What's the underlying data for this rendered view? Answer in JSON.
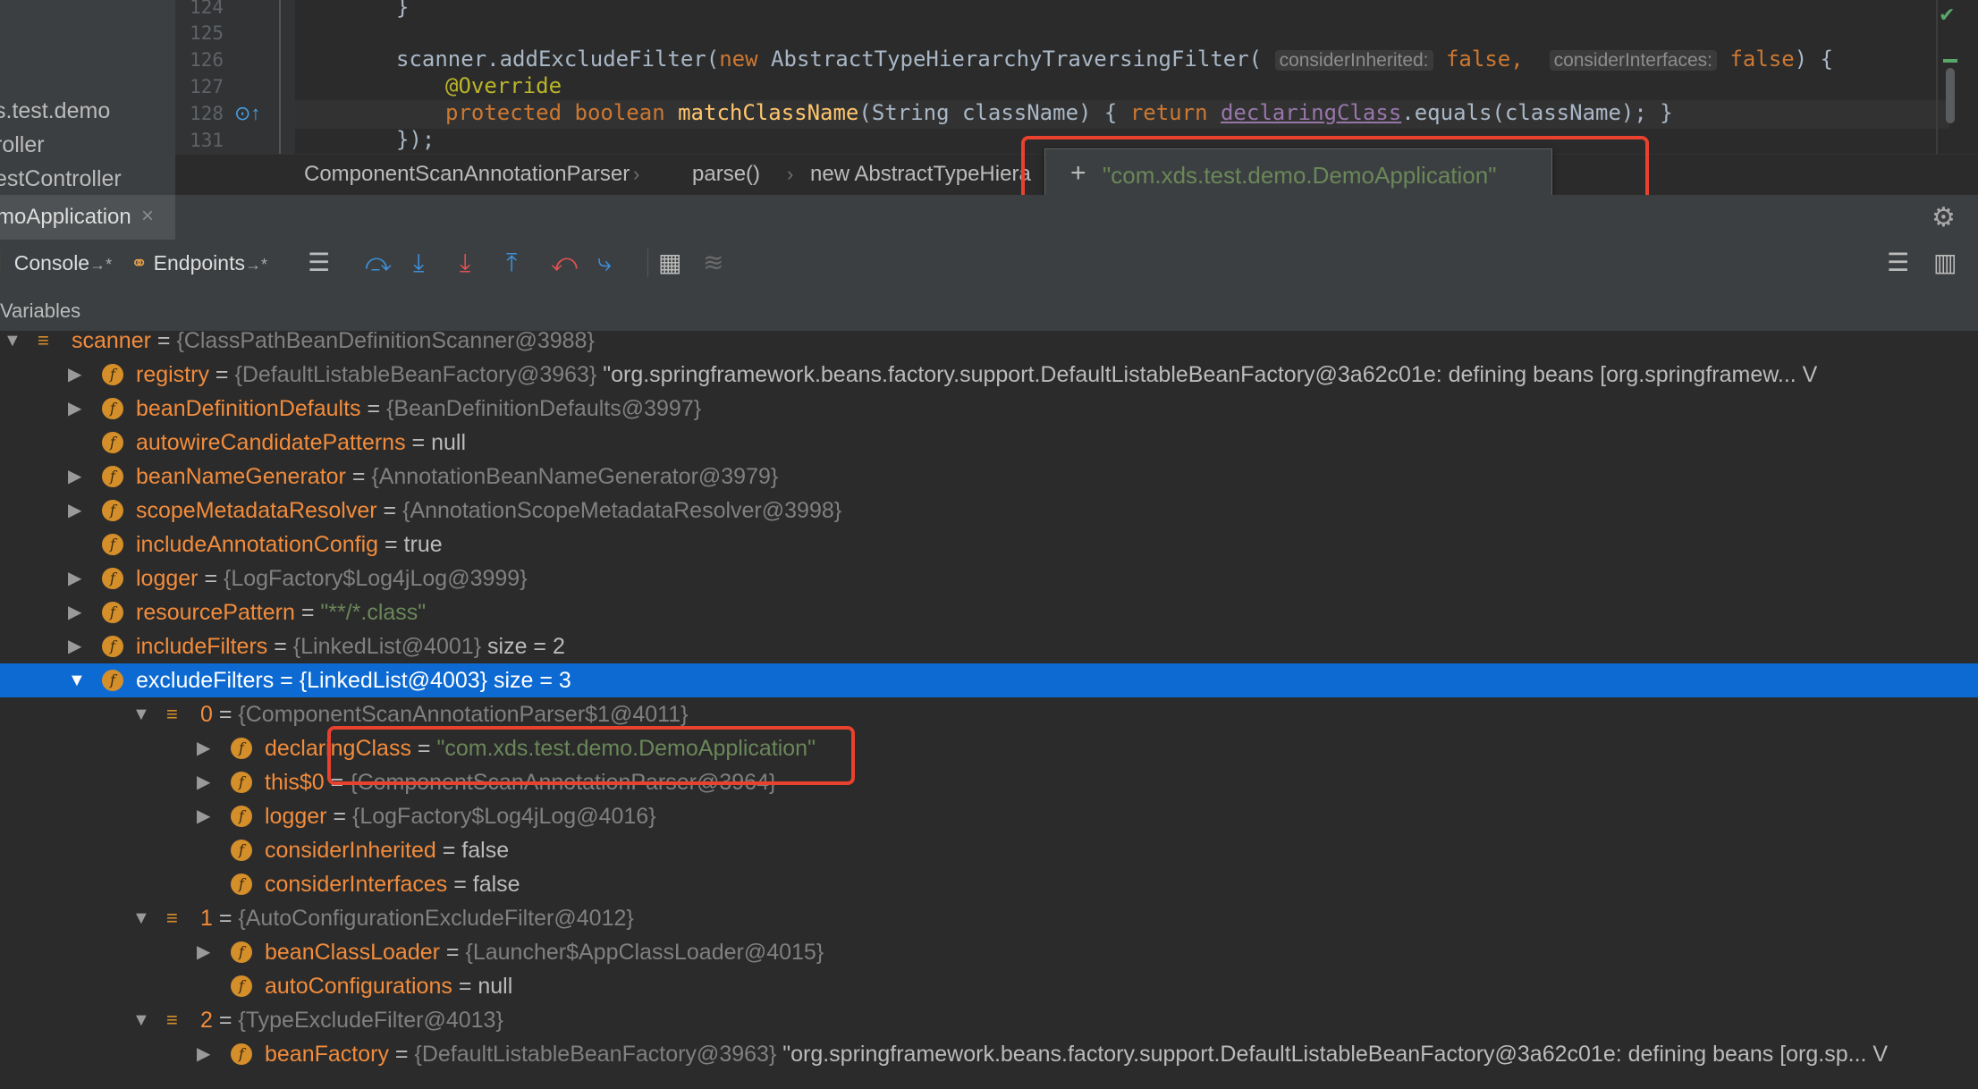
{
  "project": {
    "items": [
      "s.test.demo",
      "roller",
      "estController"
    ]
  },
  "editor": {
    "line_numbers": [
      "124",
      "125",
      "126",
      "127",
      "128",
      "131"
    ],
    "line_124": "}",
    "line_126_call": "scanner.addExcludeFilter(",
    "line_126_new": "new",
    "line_126_class": " AbstractTypeHierarchyTraversingFilter(",
    "hint_inherited": "considerInherited:",
    "hint_interfaces": "considerInterfaces:",
    "false_kw": "false",
    "line_126_close": ") {",
    "line_127": "@Override",
    "line_128_mods": "protected boolean ",
    "line_128_method": "matchClassName",
    "line_128_params": "(String className) { ",
    "line_128_return": "return ",
    "line_128_field": "declaringClass",
    "line_128_rest": ".equals(className); }",
    "line_131": "});"
  },
  "breadcrumbs": [
    "ComponentScanAnnotationParser",
    "parse()",
    "new AbstractTypeHiera"
  ],
  "tooltip": {
    "plus": "+",
    "value": "\"com.xds.test.demo.DemoApplication\""
  },
  "run_tab": {
    "label": "moApplication",
    "close": "×"
  },
  "toolbar": {
    "console": "Console",
    "endpoints": "Endpoints",
    "pin": "→*"
  },
  "variables_header": "Variables",
  "tree": [
    {
      "indent": 0,
      "expand": "down",
      "icon": "list",
      "name": "scanner",
      "eq": " = ",
      "type": "{ClassPathBeanDefinitionScanner@3988}",
      "value": "",
      "vclass": ""
    },
    {
      "indent": 1,
      "expand": "right",
      "icon": "field",
      "name": "registry",
      "eq": " = ",
      "type": "{DefaultListableBeanFactory@3963}",
      "value": " \"org.springframework.beans.factory.support.DefaultListableBeanFactory@3a62c01e: defining beans [org.springframew... V",
      "vclass": "plain"
    },
    {
      "indent": 1,
      "expand": "right",
      "icon": "field",
      "name": "beanDefinitionDefaults",
      "eq": " = ",
      "type": "{BeanDefinitionDefaults@3997}",
      "value": "",
      "vclass": ""
    },
    {
      "indent": 1,
      "expand": "none",
      "icon": "field",
      "name": "autowireCandidatePatterns",
      "eq": " = ",
      "type": "",
      "value": "null",
      "vclass": "plain"
    },
    {
      "indent": 1,
      "expand": "right",
      "icon": "field",
      "name": "beanNameGenerator",
      "eq": " = ",
      "type": "{AnnotationBeanNameGenerator@3979}",
      "value": "",
      "vclass": ""
    },
    {
      "indent": 1,
      "expand": "right",
      "icon": "field",
      "name": "scopeMetadataResolver",
      "eq": " = ",
      "type": "{AnnotationScopeMetadataResolver@3998}",
      "value": "",
      "vclass": ""
    },
    {
      "indent": 1,
      "expand": "none",
      "icon": "field",
      "name": "includeAnnotationConfig",
      "eq": " = ",
      "type": "",
      "value": "true",
      "vclass": "plain"
    },
    {
      "indent": 1,
      "expand": "right",
      "icon": "field",
      "name": "logger",
      "eq": " = ",
      "type": "{LogFactory$Log4jLog@3999}",
      "value": "",
      "vclass": ""
    },
    {
      "indent": 1,
      "expand": "right",
      "icon": "field",
      "name": "resourcePattern",
      "eq": " = ",
      "type": "",
      "value": "\"**/*.class\"",
      "vclass": "str"
    },
    {
      "indent": 1,
      "expand": "right",
      "icon": "field",
      "name": "includeFilters",
      "eq": " = ",
      "type": "{LinkedList@4001}",
      "value": "  size = 2",
      "vclass": "plain"
    },
    {
      "indent": 1,
      "expand": "down",
      "icon": "field",
      "name": "excludeFilters",
      "eq": " = ",
      "type": "{LinkedList@4003}",
      "value": "  size = 3",
      "vclass": "plain",
      "selected": true
    },
    {
      "indent": 2,
      "expand": "down",
      "icon": "list",
      "name": "0",
      "eq": " = ",
      "type": "{ComponentScanAnnotationParser$1@4011}",
      "value": "",
      "vclass": ""
    },
    {
      "indent": 3,
      "expand": "right",
      "icon": "field",
      "name": "declaringClass",
      "eq": " = ",
      "type": "",
      "value": "\"com.xds.test.demo.DemoApplication\"",
      "vclass": "str"
    },
    {
      "indent": 3,
      "expand": "right",
      "icon": "field",
      "name": "this$0",
      "eq": " = ",
      "type": "{ComponentScanAnnotationParser@3964}",
      "value": "",
      "vclass": ""
    },
    {
      "indent": 3,
      "expand": "right",
      "icon": "field",
      "name": "logger",
      "eq": " = ",
      "type": "{LogFactory$Log4jLog@4016}",
      "value": "",
      "vclass": ""
    },
    {
      "indent": 3,
      "expand": "none",
      "icon": "field",
      "name": "considerInherited",
      "eq": " = ",
      "type": "",
      "value": "false",
      "vclass": "plain"
    },
    {
      "indent": 3,
      "expand": "none",
      "icon": "field",
      "name": "considerInterfaces",
      "eq": " = ",
      "type": "",
      "value": "false",
      "vclass": "plain"
    },
    {
      "indent": 2,
      "expand": "down",
      "icon": "list",
      "name": "1",
      "eq": " = ",
      "type": "{AutoConfigurationExcludeFilter@4012}",
      "value": "",
      "vclass": ""
    },
    {
      "indent": 3,
      "expand": "right",
      "icon": "field",
      "name": "beanClassLoader",
      "eq": " = ",
      "type": "{Launcher$AppClassLoader@4015}",
      "value": "",
      "vclass": ""
    },
    {
      "indent": 3,
      "expand": "none",
      "icon": "field",
      "name": "autoConfigurations",
      "eq": " = ",
      "type": "",
      "value": "null",
      "vclass": "plain"
    },
    {
      "indent": 2,
      "expand": "down",
      "icon": "list",
      "name": "2",
      "eq": " = ",
      "type": "{TypeExcludeFilter@4013}",
      "value": "",
      "vclass": ""
    },
    {
      "indent": 3,
      "expand": "right",
      "icon": "field",
      "name": "beanFactory",
      "eq": " = ",
      "type": "{DefaultListableBeanFactory@3963}",
      "value": " \"org.springframework.beans.factory.support.DefaultListableBeanFactory@3a62c01e: defining beans [org.sp... V",
      "vclass": "plain"
    }
  ],
  "colors": {
    "highlight_box": "#e8412e",
    "selection": "#0d6ad3",
    "string": "#6a8759",
    "field_name": "#f28c3c"
  }
}
